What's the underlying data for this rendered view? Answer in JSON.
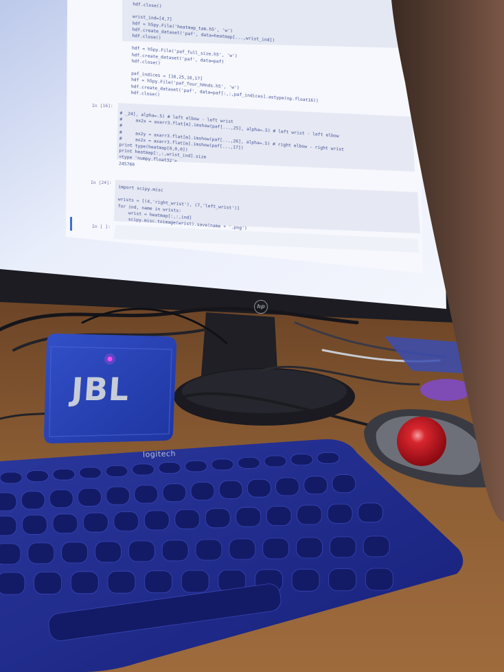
{
  "scene": {
    "description_colors": {
      "desk": "#8a5a32",
      "screen": "#e7ecf8",
      "keyboard": "#1e2a8c",
      "speaker": "#2c45b8",
      "trackball": "#c8141e"
    }
  },
  "monitor": {
    "brand": "hp",
    "notebook": {
      "cells": [
        {
          "prompt": "",
          "lines": [
            "    hdf.close()",
            "",
            "    wrist_ind=[4,7]",
            "    hdf = h5py.File('heatmap_tam.h5', 'w')",
            "    hdf.create_dataset('paf', data=heatmap[...,wrist_ind])",
            "    hdf.close()",
            "",
            "    hdf = h5py.File('paf_full_size.h5', 'w')",
            "    hdf.create_dataset('paf', data=paf)",
            "    hdf.close()",
            "",
            "    paf_indices = [16,25,16,17]",
            "    hdf = h5py.File('paf_four_hHnds.h5', 'w')",
            "    hdf.create_dataset('paf', data=paf[:,:,paf_indices].astype(np.float16))",
            "    hdf.close()"
          ]
        },
        {
          "prompt": "In [16]:",
          "lines": [
            "# _24], alpha=.5) # left elbow - left wrist",
            "#     ax2x = axarr3.flat[m].imshow(paf[...,25], alpha=.5) # left wrist - left elbow",
            "#",
            "#     ax2y = axarr3.flat[m].imshow(paf[...,26], alpha=.5) # right elbow - right wrist",
            "#     ax2x = axarr3.flat[m].imshow(paf[...,17])",
            "print type(heatmap[0,0,0])",
            "print heatmap[:,:,wrist_ind].size",
            "<type 'numpy.float32'>",
            "245760"
          ]
        },
        {
          "prompt": "In [24]:",
          "lines": [
            "import scipy.misc",
            "",
            "wrists = [(4,'right_wrist'), (7,'left_wrist')]",
            "for ind, name in wrists:",
            "    wrist = heatmap[:,:,ind]",
            "    scipy.misc.toimage(wrist).save(name + '.png')"
          ]
        },
        {
          "prompt": "In [ ]:",
          "lines": [
            ""
          ]
        }
      ]
    }
  },
  "speaker": {
    "brand": "JBL"
  },
  "keyboard": {
    "brand": "logitech"
  }
}
